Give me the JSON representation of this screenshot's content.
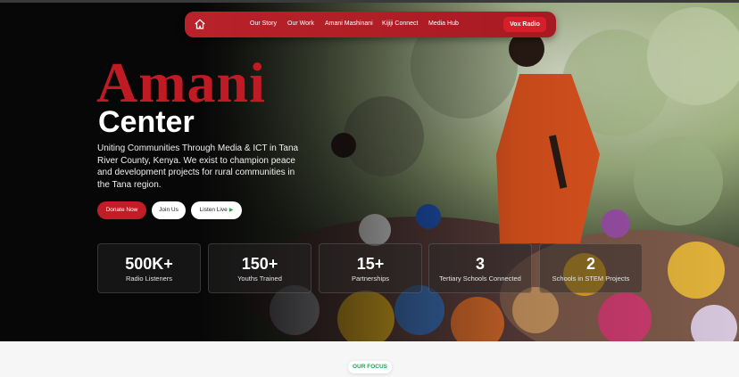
{
  "nav": {
    "home_icon": "home-icon",
    "links": [
      "Our Story",
      "Our Work",
      "Amani Mashinani",
      "Kijiji Connect",
      "Media Hub"
    ],
    "cta_label": "Vox Radio"
  },
  "hero": {
    "title_accent": "Amani",
    "title_main": "Center",
    "tagline": "Uniting Communities Through Media & ICT in Tana River County, Kenya. We exist to champion peace and development projects for rural communities in the Tana region.",
    "buttons": {
      "donate": "Donate Now",
      "join": "Join Us",
      "listen": "Listen Live"
    },
    "play_icon": "▶"
  },
  "stats": [
    {
      "value": "500K+",
      "label": "Radio Listeners"
    },
    {
      "value": "150+",
      "label": "Youths Trained"
    },
    {
      "value": "15+",
      "label": "Partnerships"
    },
    {
      "value": "3",
      "label": "Tertiary Schools Connected"
    },
    {
      "value": "2",
      "label": "Schools in STEM Projects"
    }
  ],
  "focus": {
    "badge": "OUR FOCUS"
  },
  "colors": {
    "brand_red": "#c01b24",
    "nav_red": "#b9222a",
    "cta_red": "#d61f2a",
    "focus_green": "#21a25a",
    "hero_bg": "#070707"
  }
}
